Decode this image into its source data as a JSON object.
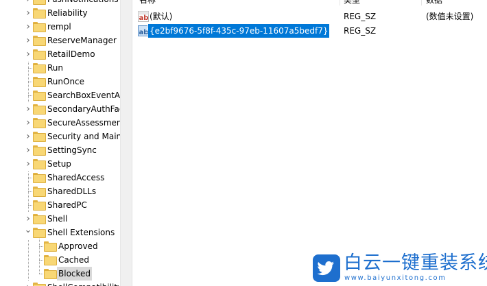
{
  "tree": {
    "items": [
      {
        "label": "PushNotifications",
        "expander": "right",
        "level": 1
      },
      {
        "label": "Reliability",
        "expander": "right",
        "level": 1
      },
      {
        "label": "rempl",
        "expander": "right",
        "level": 1
      },
      {
        "label": "ReserveManager",
        "expander": "right",
        "level": 1
      },
      {
        "label": "RetailDemo",
        "expander": "right",
        "level": 1
      },
      {
        "label": "Run",
        "expander": "none",
        "level": 1
      },
      {
        "label": "RunOnce",
        "expander": "none",
        "level": 1
      },
      {
        "label": "SearchBoxEventAr",
        "expander": "none",
        "level": 1
      },
      {
        "label": "SecondaryAuthFac",
        "expander": "right",
        "level": 1
      },
      {
        "label": "SecureAssessmen",
        "expander": "right",
        "level": 1
      },
      {
        "label": "Security and Main",
        "expander": "right",
        "level": 1
      },
      {
        "label": "SettingSync",
        "expander": "right",
        "level": 1
      },
      {
        "label": "Setup",
        "expander": "right",
        "level": 1
      },
      {
        "label": "SharedAccess",
        "expander": "none",
        "level": 1
      },
      {
        "label": "SharedDLLs",
        "expander": "none",
        "level": 1
      },
      {
        "label": "SharedPC",
        "expander": "none",
        "level": 1
      },
      {
        "label": "Shell",
        "expander": "right",
        "level": 1
      },
      {
        "label": "Shell Extensions",
        "expander": "down",
        "level": 1
      },
      {
        "label": "Approved",
        "expander": "none",
        "level": 2
      },
      {
        "label": "Cached",
        "expander": "none",
        "level": 2
      },
      {
        "label": "Blocked",
        "expander": "none",
        "level": 2,
        "selected": true
      },
      {
        "label": "ShellCompatibility",
        "expander": "right",
        "level": 1
      }
    ]
  },
  "list": {
    "columns": {
      "name": "名称",
      "type": "类型",
      "data": "数据"
    },
    "rows": [
      {
        "name": "(默认)",
        "type": "REG_SZ",
        "data": "(数值未设置)",
        "selected": false
      },
      {
        "name": "{e2bf9676-5f8f-435c-97eb-11607a5bedf7}",
        "type": "REG_SZ",
        "data": "",
        "selected": true
      }
    ]
  },
  "icons": {
    "folder": "folder-icon",
    "value": "string-value-icon",
    "collapsed": "chevron-right-icon",
    "expanded": "chevron-down-icon",
    "watermark_logo": "twitter-bird-icon"
  },
  "colors": {
    "selection": "#0078d7",
    "tree_selection": "#d9d9d9",
    "folder": "#f8d775",
    "watermark": "#1e6fce"
  },
  "watermark": {
    "title": "白云一键重装系统",
    "url": "www.baiyunxitong.com"
  }
}
